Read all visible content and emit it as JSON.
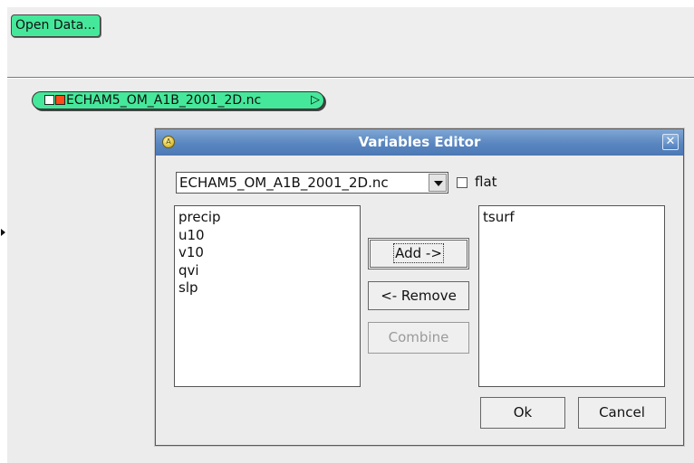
{
  "toolbar": {
    "open_data_label": "Open Data..."
  },
  "dataset_node": {
    "label": "ECHAM5_OM_A1B_2001_2D.nc",
    "arrow_glyph": "▷"
  },
  "dialog": {
    "title": "Variables Editor",
    "close_glyph": "✕",
    "dataset_select": {
      "value": "ECHAM5_OM_A1B_2001_2D.nc"
    },
    "flat_checkbox": {
      "label": "flat",
      "checked": false
    },
    "available_variables": [
      "precip",
      "u10",
      "v10",
      "qvi",
      "slp"
    ],
    "selected_variables": [
      "tsurf"
    ],
    "buttons": {
      "add": "Add ->",
      "remove": "<- Remove",
      "combine": "Combine",
      "ok": "Ok",
      "cancel": "Cancel"
    }
  },
  "colors": {
    "node_green": "#45e89a",
    "node_orange": "#ff4b1a",
    "titlebar_blue": "#5a86c0"
  },
  "icons": {
    "title_icon": "app-logo-icon",
    "close_icon": "close-icon",
    "dropdown_icon": "chevron-down-icon",
    "node_output_icon": "triangle-right-icon"
  }
}
